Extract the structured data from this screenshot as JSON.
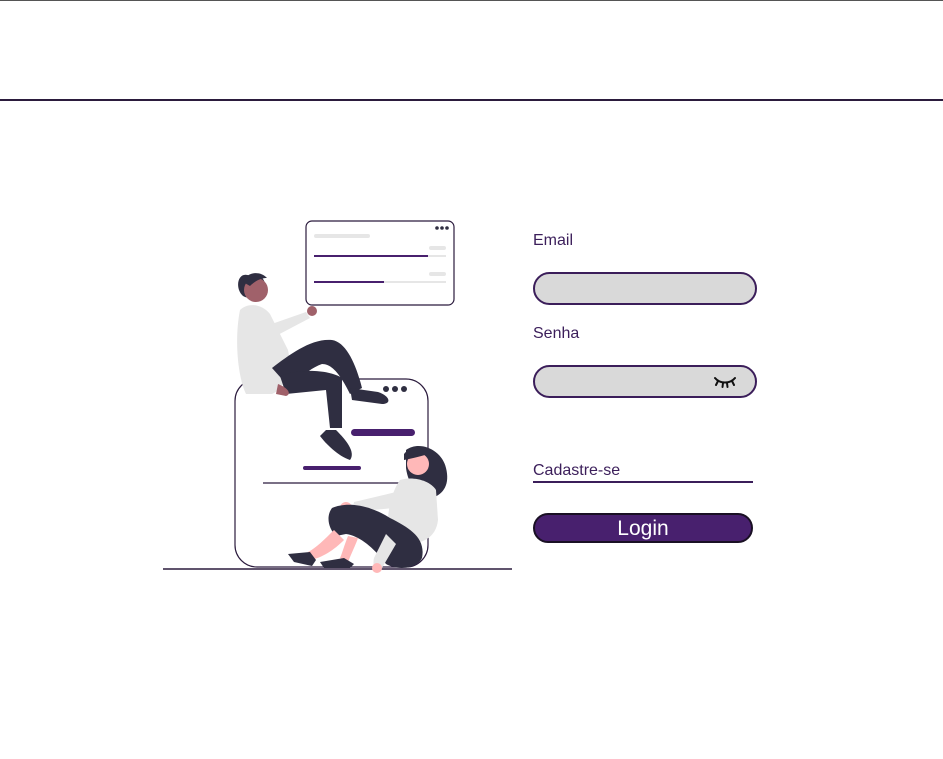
{
  "form": {
    "email_label": "Email",
    "email_value": "",
    "password_label": "Senha",
    "password_value": "",
    "password_toggle_icon": "eye-closed-icon",
    "signup_link": "Cadastre-se",
    "login_button": "Login"
  },
  "colors": {
    "accent": "#48206e",
    "text": "#3b1e5a",
    "input_bg": "#d9d9d9"
  }
}
